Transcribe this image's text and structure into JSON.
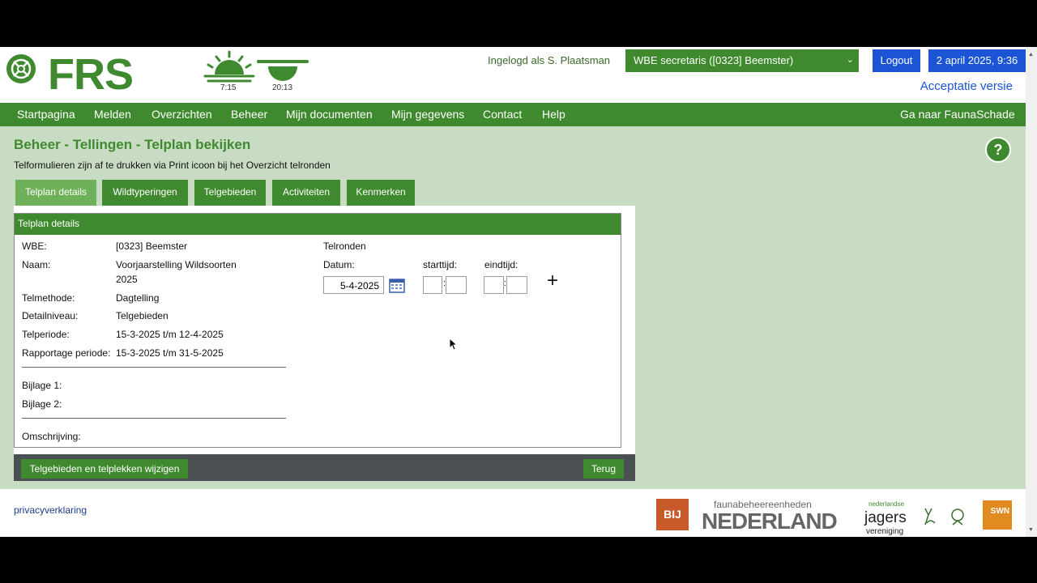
{
  "header": {
    "logo_text": "FRS",
    "sunrise": "7:15",
    "sunset": "20:13",
    "logged_in": "Ingelogd als S. Plaatsman",
    "role": "WBE secretaris ([0323] Beemster)",
    "logout": "Logout",
    "datetime": "2 april 2025, 9:36",
    "version": "Acceptatie versie"
  },
  "nav": {
    "items": [
      "Startpagina",
      "Melden",
      "Overzichten",
      "Beheer",
      "Mijn documenten",
      "Mijn gegevens",
      "Contact",
      "Help"
    ],
    "right": "Ga naar FaunaSchade"
  },
  "page": {
    "title": "Beheer - Tellingen - Telplan bekijken",
    "subtitle": "Telformulieren zijn af te drukken via Print icoon bij het Overzicht telronden",
    "help": "?"
  },
  "tabs": [
    "Telplan details",
    "Wildtyperingen",
    "Telgebieden",
    "Activiteiten",
    "Kenmerken"
  ],
  "panel": {
    "header": "Telplan details",
    "fields": [
      {
        "label": "WBE:",
        "value": "[0323] Beemster"
      },
      {
        "label": "Naam:",
        "value": "Voorjaarstelling Wildsoorten",
        "value2": "2025"
      },
      {
        "label": "Telmethode:",
        "value": "Dagtelling"
      },
      {
        "label": "Detailniveau:",
        "value": "Telgebieden"
      },
      {
        "label": "Telperiode:",
        "value": "15-3-2025 t/m 12-4-2025"
      },
      {
        "label": "Rapportage periode:",
        "value": "15-3-2025 t/m 31-5-2025"
      }
    ],
    "bijlage1": "Bijlage 1:",
    "bijlage2": "Bijlage 2:",
    "omschrijving": "Omschrijving:",
    "telronden": {
      "title": "Telronden",
      "datum_label": "Datum:",
      "start_label": "starttijd:",
      "eind_label": "eindtijd:",
      "datum_value": "5-4-2025",
      "time_sep": ":",
      "add": "+"
    }
  },
  "buttons": {
    "edit": "Telgebieden en telplekken wijzigen",
    "back": "Terug"
  },
  "footer": {
    "privacy": "privacyverklaring",
    "logo_bij": "BIJ 12",
    "fbe_small": "faunabeheereenheden",
    "fbe_big": "NEDERLAND",
    "jagers_small": "nederlandse",
    "jagers_big": "jagers",
    "jagers_sub": "vereniging",
    "swn": "SWN"
  },
  "colors": {
    "green": "#3f8a2f",
    "light_green_bg": "#c8dcc4",
    "blue": "#1b55d6"
  }
}
